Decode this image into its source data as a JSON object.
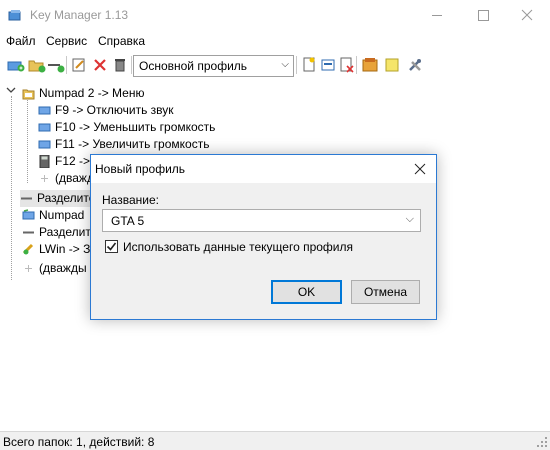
{
  "window": {
    "title": "Key Manager 1.13"
  },
  "menu": [
    "Файл",
    "Сервис",
    "Справка"
  ],
  "toolbar": {
    "profile_value": "Основной профиль"
  },
  "tree": {
    "root_label": "Numpad 2 -> Меню",
    "children": [
      "F9 -> Отключить звук",
      "F10 -> Уменьшить громкость",
      "F11 -> Увеличить громкость",
      "F12 ->",
      "(дважды"
    ],
    "items": [
      "Разделите",
      "Numpad",
      "Разделите",
      "LWin -> З",
      "(дважды"
    ]
  },
  "status": {
    "text": "Всего папок: 1, действий: 8"
  },
  "dialog": {
    "title": "Новый профиль",
    "name_label": "Название:",
    "name_value": "GTA 5",
    "checkbox_label": "Использовать данные текущего профиля",
    "checkbox_checked": true,
    "ok_label": "OK",
    "cancel_label": "Отмена"
  }
}
